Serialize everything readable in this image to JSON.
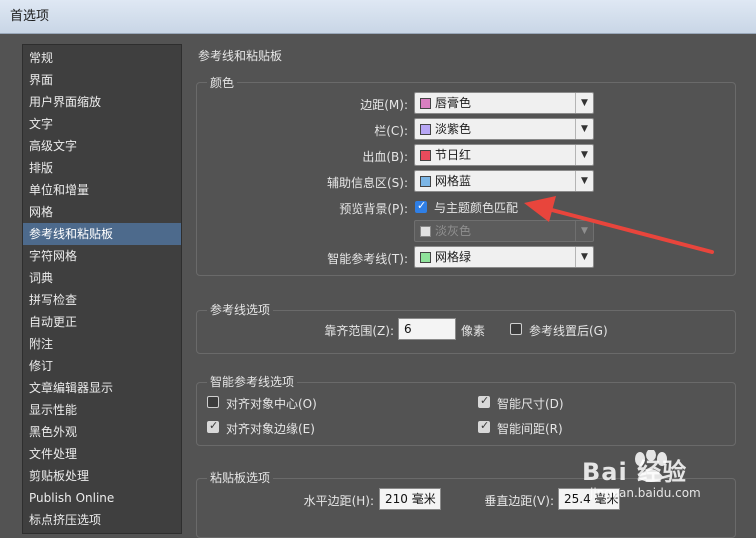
{
  "window": {
    "title": "首选项"
  },
  "sidebar": {
    "items": [
      {
        "label": "常规",
        "active": false
      },
      {
        "label": "界面",
        "active": false
      },
      {
        "label": "用户界面缩放",
        "active": false
      },
      {
        "label": "文字",
        "active": false
      },
      {
        "label": "高级文字",
        "active": false
      },
      {
        "label": "排版",
        "active": false
      },
      {
        "label": "单位和增量",
        "active": false
      },
      {
        "label": "网格",
        "active": false
      },
      {
        "label": "参考线和粘贴板",
        "active": true
      },
      {
        "label": "字符网格",
        "active": false
      },
      {
        "label": "词典",
        "active": false
      },
      {
        "label": "拼写检查",
        "active": false
      },
      {
        "label": "自动更正",
        "active": false
      },
      {
        "label": "附注",
        "active": false
      },
      {
        "label": "修订",
        "active": false
      },
      {
        "label": "文章编辑器显示",
        "active": false
      },
      {
        "label": "显示性能",
        "active": false
      },
      {
        "label": "黑色外观",
        "active": false
      },
      {
        "label": "文件处理",
        "active": false
      },
      {
        "label": "剪贴板处理",
        "active": false
      },
      {
        "label": "Publish Online",
        "active": false
      },
      {
        "label": "标点挤压选项",
        "active": false
      }
    ]
  },
  "main": {
    "title": "参考线和粘贴板",
    "color_group": {
      "title": "颜色",
      "margins": {
        "label": "边距(M):",
        "value": "唇膏色",
        "color": "#d97fc0"
      },
      "columns": {
        "label": "栏(C):",
        "value": "淡紫色",
        "color": "#b7a6f4"
      },
      "bleed": {
        "label": "出血(B):",
        "value": "节日红",
        "color": "#ea4b5c"
      },
      "slug": {
        "label": "辅助信息区(S):",
        "value": "网格蓝",
        "color": "#7cb6e6"
      },
      "preview": {
        "label": "预览背景(P):",
        "checkbox_label": "与主题颜色匹配",
        "checked": true
      },
      "preview_color": {
        "value": "淡灰色",
        "color": "#e2e2e2"
      },
      "smart_guides": {
        "label": "智能参考线(T):",
        "value": "网格绿",
        "color": "#8fe39b"
      }
    },
    "guide_options": {
      "title": "参考线选项",
      "snap_label": "靠齐范围(Z):",
      "snap_value": "6",
      "snap_unit": "像素",
      "guides_back_label": "参考线置后(G)",
      "guides_back_checked": false
    },
    "smart_guide_options": {
      "title": "智能参考线选项",
      "align_center": {
        "label": "对齐对象中心(O)",
        "checked": false
      },
      "smart_dimensions": {
        "label": "智能尺寸(D)",
        "checked": true
      },
      "align_edges": {
        "label": "对齐对象边缘(E)",
        "checked": true
      },
      "smart_spacing": {
        "label": "智能间距(R)",
        "checked": true
      }
    },
    "pasteboard_options": {
      "title": "粘贴板选项",
      "horizontal_label": "水平边距(H):",
      "horizontal_value": "210 毫米",
      "vertical_label": "垂直边距(V):",
      "vertical_value": "25.4 毫米"
    }
  },
  "watermark": {
    "text": "Bai 经验",
    "url_text": "jingyan.baidu.com",
    "color": "#ffffff"
  },
  "annotation": {
    "arrow_color": "#e8453c"
  }
}
